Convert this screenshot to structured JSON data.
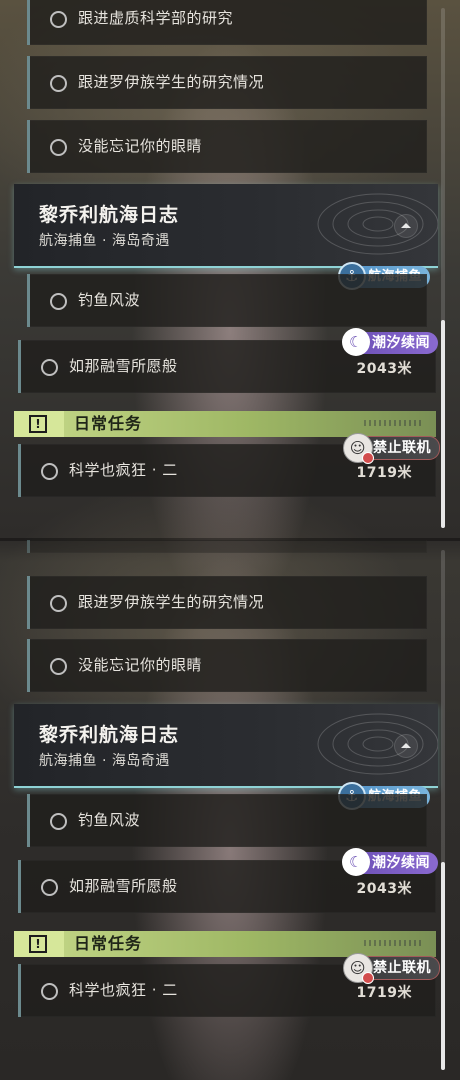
{
  "quest_list_top": {
    "prev_quests": [
      "跟进虚质科学部的研究",
      "跟进罗伊族学生的研究情况",
      "没能忘记你的眼睛"
    ],
    "chapter": {
      "title": "黎乔利航海日志",
      "subtitle": "航海捕鱼 · 海岛奇遇"
    },
    "fishing_badge": "航海捕鱼",
    "quest_fishing": "钓鱼风波",
    "quest_snow": {
      "label": "如那融雪所愿般",
      "badge": "潮汐续闻",
      "distance": "2043米"
    },
    "daily_header": "日常任务",
    "daily_quest": {
      "label": "科学也疯狂 · 二",
      "badge": "禁止联机",
      "distance": "1719米"
    }
  },
  "quest_list_bottom": {
    "prev_quests": [
      "跟进罗伊族学生的研究情况",
      "没能忘记你的眼睛"
    ],
    "chapter": {
      "title": "黎乔利航海日志",
      "subtitle": "航海捕鱼 · 海岛奇遇"
    },
    "fishing_badge": "航海捕鱼",
    "quest_fishing": "钓鱼风波",
    "quest_snow": {
      "label": "如那融雪所愿般",
      "badge": "潮汐续闻",
      "distance": "2043米"
    },
    "daily_header": "日常任务",
    "daily_quest": {
      "label": "科学也疯狂 · 二",
      "badge": "禁止联机",
      "distance": "1719米"
    }
  },
  "icons": {
    "quest_marker": "circle-icon",
    "collapse": "chevron-up-icon",
    "fishing": "fish-hook-icon",
    "tide": "moon-icon",
    "coop_banned": "no-coop-icon",
    "daily": "exclamation-icon"
  },
  "colors": {
    "accent_cyan": "#8fd3d6",
    "daily_green": "#c6d98a",
    "tide_purple": "#6b4fb5",
    "fishing_blue": "#4e8ec5"
  }
}
